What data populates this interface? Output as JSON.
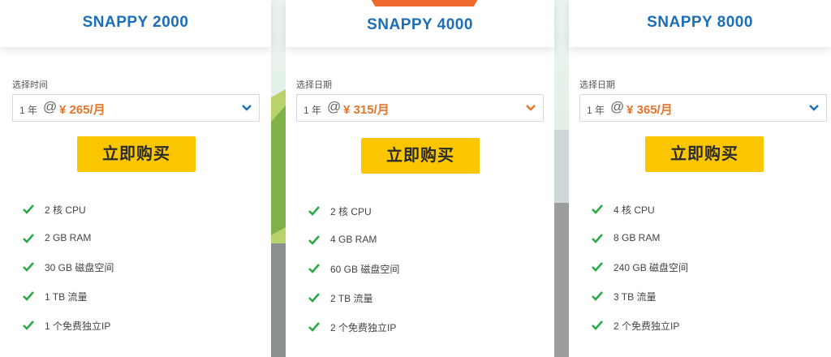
{
  "plans": [
    {
      "name": "SNAPPY 2000",
      "term_label": "选择时间",
      "term": "1 年",
      "at": "@",
      "price": "¥ 265/月",
      "buy_label": "立即购买",
      "chevron_color": "#1b6fb8",
      "features": [
        "2 核 CPU",
        "2 GB RAM",
        "30 GB 磁盘空间",
        "1 TB 流量",
        "1 个免费独立IP"
      ]
    },
    {
      "name": "SNAPPY 4000",
      "recommended": true,
      "term_label": "选择日期",
      "term": "1 年",
      "at": "@",
      "price": "¥ 315/月",
      "buy_label": "立即购买",
      "chevron_color": "#e8742a",
      "features": [
        "2 核 CPU",
        "4 GB RAM",
        "60 GB 磁盘空间",
        "2 TB 流量",
        "2 个免费独立IP"
      ]
    },
    {
      "name": "SNAPPY 8000",
      "term_label": "选择日期",
      "term": "1 年",
      "at": "@",
      "price": "¥ 365/月",
      "buy_label": "立即购买",
      "chevron_color": "#1b6fb8",
      "features": [
        "4 核 CPU",
        "8 GB RAM",
        "240 GB 磁盘空间",
        "3 TB 流量",
        "2 个免费独立IP"
      ]
    }
  ],
  "colors": {
    "plan_name": "#1b6fb8",
    "price": "#e8742a",
    "buy_button": "#f9c600",
    "check": "#2aa845",
    "badge": "#ef6a2e"
  },
  "icons": [
    "check-icon",
    "chevron-down-icon"
  ]
}
